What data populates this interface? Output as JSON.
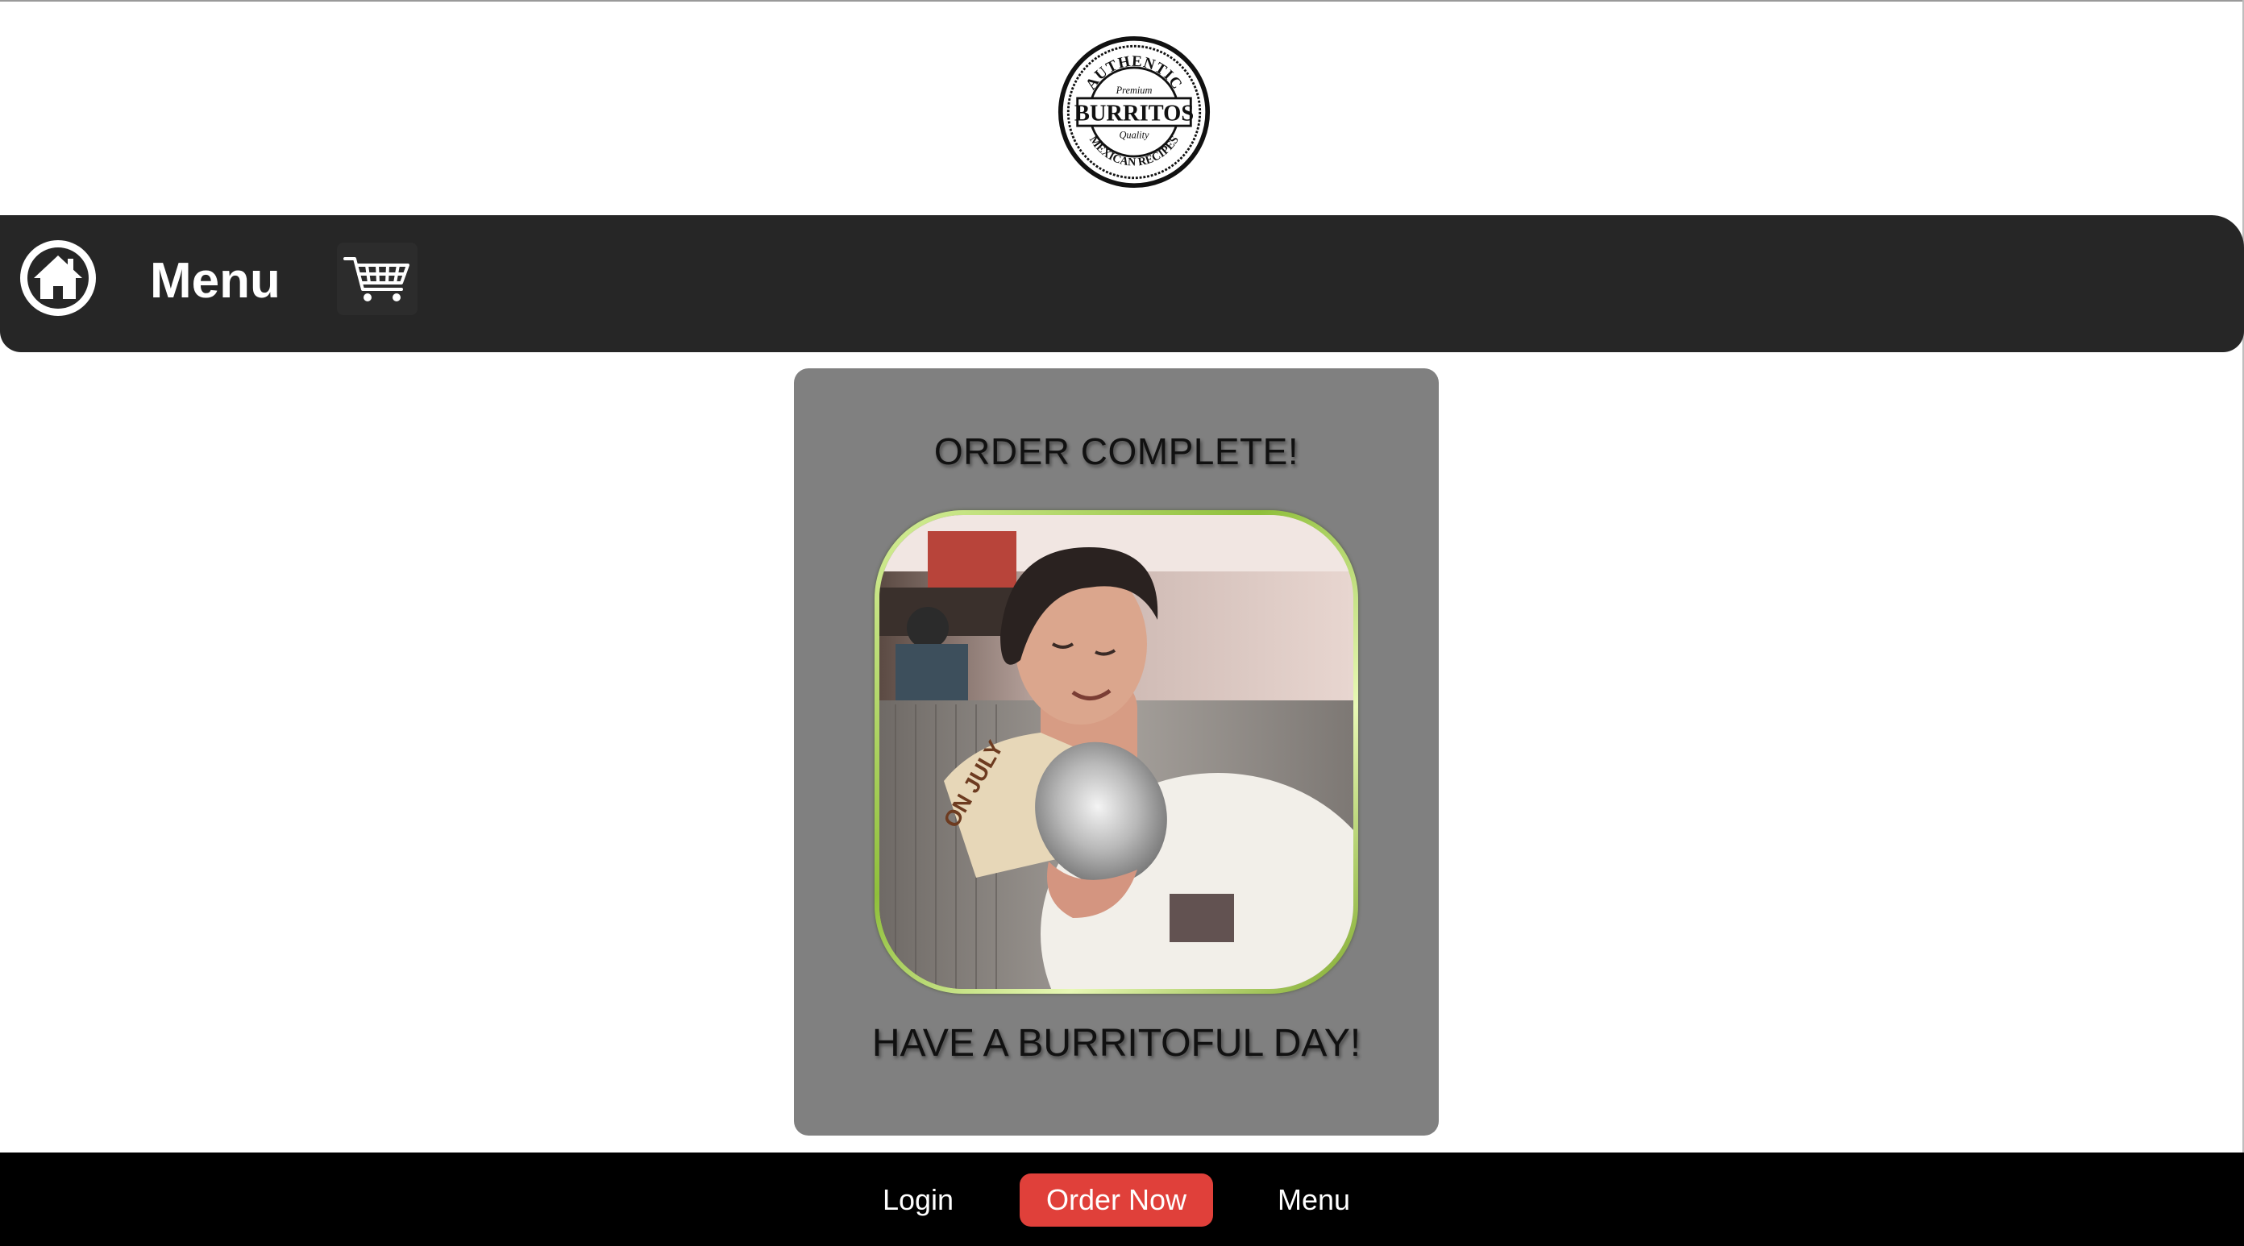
{
  "logo": {
    "name": "burritos-logo",
    "lines": [
      "AUTHENTIC",
      "Premium",
      "BURRITOS",
      "Quality",
      "MEXICAN RECIPES"
    ]
  },
  "header": {
    "home_icon": "home-icon",
    "title": "Menu",
    "cart_icon": "shopping-cart-icon"
  },
  "card": {
    "title": "ORDER COMPLETE!",
    "subtitle": "HAVE A BURRITOFUL DAY!",
    "photo_alt": "person-with-burrito-photo"
  },
  "footer": {
    "links": [
      "Login",
      "Order Now",
      "Menu"
    ]
  },
  "colors": {
    "header_bg": "#262626",
    "card_bg": "#808080",
    "footer_bg": "#000000",
    "order_button": "#e0403a",
    "frame_green": "#8fbf3b"
  }
}
